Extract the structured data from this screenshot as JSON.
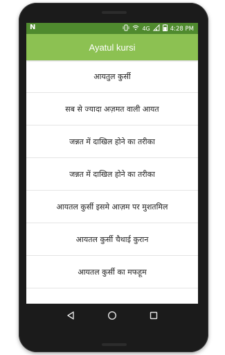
{
  "status_bar": {
    "notification_icon": "N",
    "network": "4G",
    "time": "4:28",
    "time_suffix": "PM"
  },
  "app_bar": {
    "title": "Ayatul kursi"
  },
  "list": {
    "items": [
      {
        "label": "आयतुल कुर्सी"
      },
      {
        "label": "सब से ज्यादा अज़मत वाली आयत"
      },
      {
        "label": "जन्नत में दाखिल होने का तरीका"
      },
      {
        "label": "जन्नत में दाखिल होने का तरीका"
      },
      {
        "label": "आयतल कुर्सी इसमे आज़म पर मुशतमिल"
      },
      {
        "label": "आयतल कुर्सी चैथाई कुरान"
      },
      {
        "label": "आयतल कुर्सी का मफहूम"
      }
    ]
  },
  "colors": {
    "status_bar": "#4f8a2e",
    "app_bar": "#8cc152",
    "phone_body": "#1b1b1b"
  },
  "icons": {
    "nav_back": "back-triangle-icon",
    "nav_home": "home-circle-icon",
    "nav_recents": "recents-square-icon"
  }
}
